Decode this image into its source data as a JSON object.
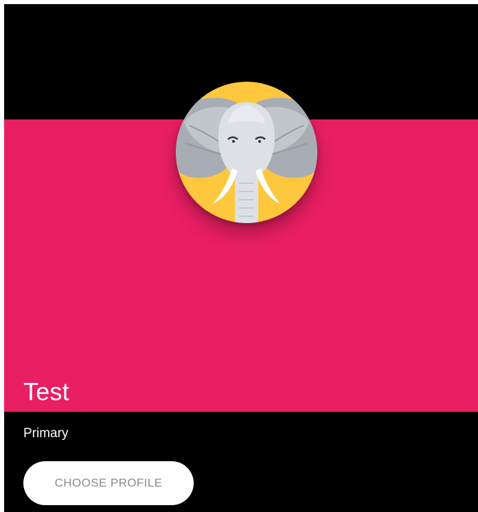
{
  "profile": {
    "name": "Test",
    "subtitle": "Primary",
    "button_label": "CHOOSE PROFILE",
    "avatar_icon": "elephant-icon"
  },
  "colors": {
    "card_background": "#e91e63",
    "page_background": "#000000",
    "avatar_background": "#fdc83e",
    "button_background": "#ffffff",
    "button_text": "#8a8a8a",
    "text_primary": "#ffffff"
  }
}
